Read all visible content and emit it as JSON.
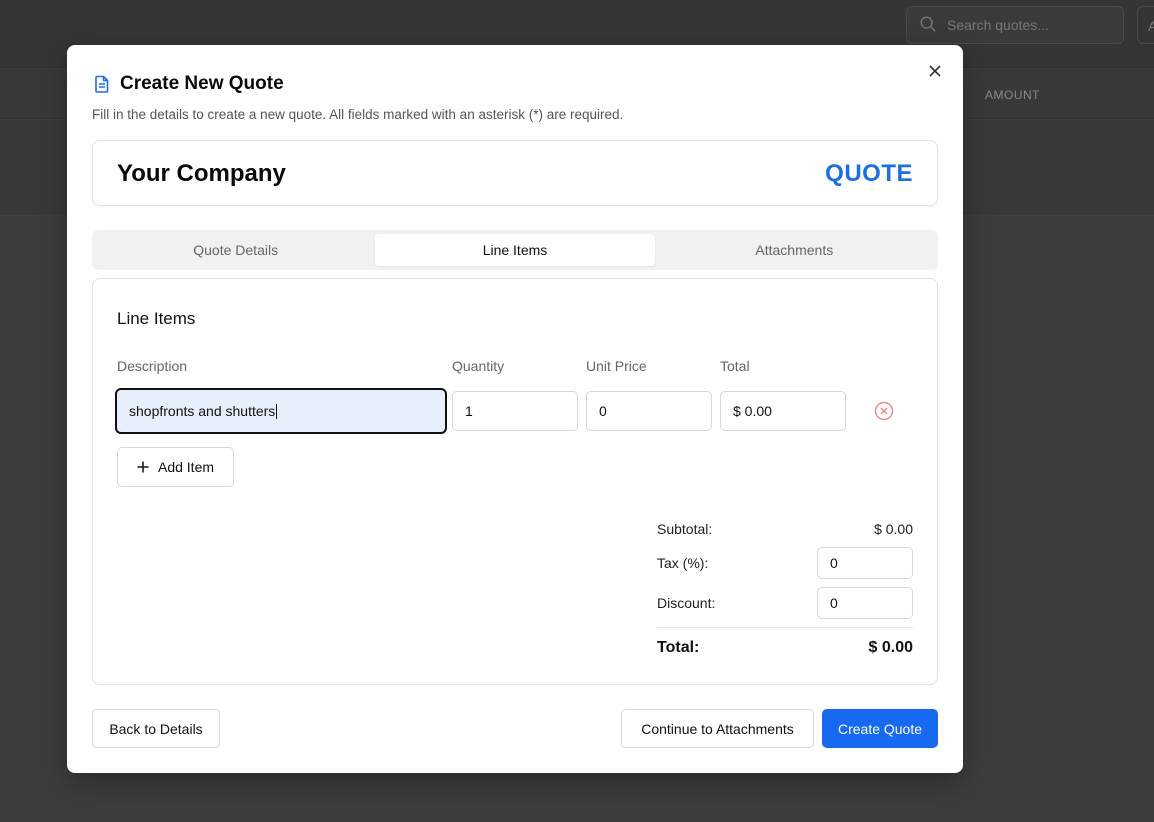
{
  "background": {
    "search_placeholder": "Search quotes...",
    "extra_button_letter": "A",
    "column_amount": "AMOUNT"
  },
  "modal": {
    "title": "Create New Quote",
    "description": "Fill in the details to create a new quote. All fields marked with an asterisk (*) are required.",
    "company_name": "Your Company",
    "doc_label": "QUOTE"
  },
  "tabs": [
    {
      "label": "Quote Details",
      "active": false
    },
    {
      "label": "Line Items",
      "active": true
    },
    {
      "label": "Attachments",
      "active": false
    }
  ],
  "line_items": {
    "title": "Line Items",
    "columns": {
      "description": "Description",
      "quantity": "Quantity",
      "unit_price": "Unit Price",
      "total": "Total"
    },
    "rows": [
      {
        "description": "shopfronts and shutters",
        "quantity": "1",
        "unit_price": "0",
        "total": "$ 0.00"
      }
    ],
    "add_item_label": "Add Item"
  },
  "summary": {
    "subtotal_label": "Subtotal:",
    "subtotal_value": "$ 0.00",
    "tax_label": "Tax (%):",
    "tax_value": "0",
    "discount_label": "Discount:",
    "discount_value": "0",
    "total_label": "Total:",
    "total_value": "$ 0.00"
  },
  "footer": {
    "back_label": "Back to Details",
    "continue_label": "Continue to Attachments",
    "create_label": "Create Quote"
  },
  "colors": {
    "accent": "#1a6fe3",
    "primary_button": "#1669f0",
    "remove_icon": "#f08a8a",
    "focused_field_bg": "#e8effc"
  }
}
